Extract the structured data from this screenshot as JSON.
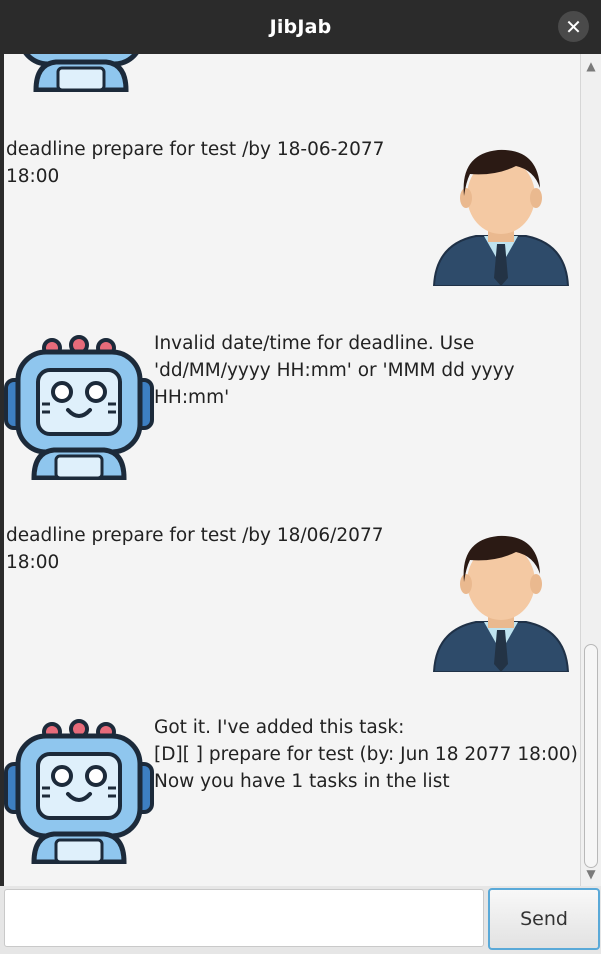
{
  "window": {
    "title": "JibJab",
    "close_glyph": "✕"
  },
  "dialogs": [
    {
      "sender": "user",
      "text": "deadline prepare for test /by 18-06-2077\n18:00"
    },
    {
      "sender": "bot",
      "text": "Invalid date/time for deadline. Use\n'dd/MM/yyyy HH:mm' or 'MMM dd yyyy\nHH:mm'"
    },
    {
      "sender": "user",
      "text": "deadline prepare for test /by 18/06/2077\n18:00"
    },
    {
      "sender": "bot",
      "text": "Got it. I've added this task:\n[D][ ] prepare for test (by: Jun 18 2077 18:00)\nNow you have 1 tasks in the list"
    }
  ],
  "bot_avatar_label": "AI",
  "input": {
    "value": "",
    "placeholder": ""
  },
  "send_label": "Send",
  "icons": {
    "bot": "robot-avatar-icon",
    "user": "user-avatar-icon",
    "close": "close-icon"
  },
  "colors": {
    "titlebar": "#2b2b2b",
    "chat_bg": "#f4f4f4",
    "send_border": "#5aa9d8"
  }
}
